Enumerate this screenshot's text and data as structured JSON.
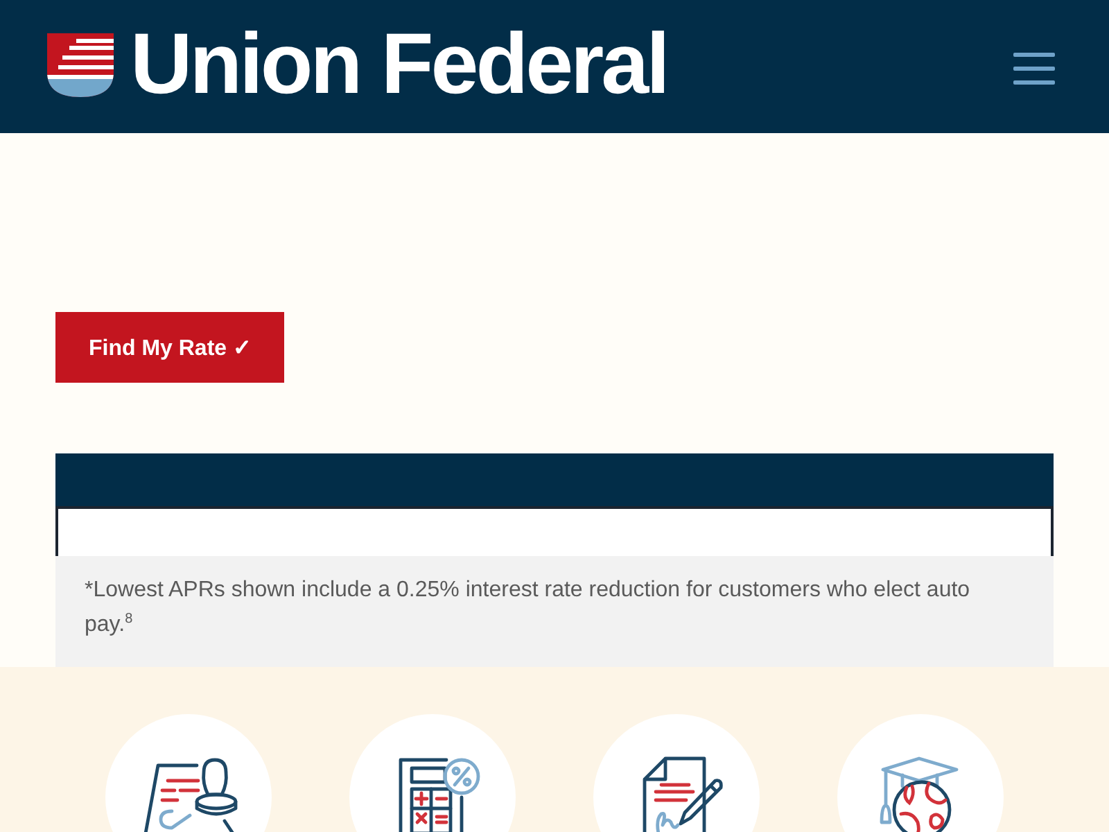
{
  "header": {
    "logo_text": "Union Federal"
  },
  "rate_button": {
    "label": "Find My Rate ✓"
  },
  "rates_table": {
    "note": "*Lowest APRs shown include a 0.25% interest rate reduction for customers who elect auto pay.$^{8}$"
  },
  "features": [
    {
      "kind": "stamp"
    },
    {
      "kind": "calculator"
    },
    {
      "kind": "signature"
    },
    {
      "kind": "education"
    }
  ]
}
